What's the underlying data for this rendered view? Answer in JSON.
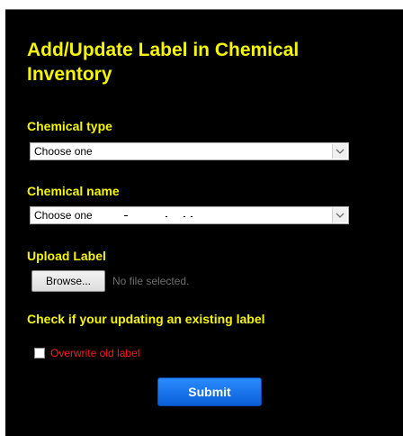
{
  "form": {
    "title": "Add/Update Label in Chemical Inventory",
    "chemical_type": {
      "label": "Chemical type",
      "selected": "Choose one"
    },
    "chemical_name": {
      "label": "Chemical name",
      "selected": "Choose one"
    },
    "upload": {
      "label": "Upload Label",
      "browse_label": "Browse...",
      "status": "No file selected."
    },
    "overwrite": {
      "heading": "Check if your updating an existing label",
      "checkbox_label": "Overwrite old label",
      "checked": false
    },
    "submit_label": "Submit"
  },
  "colors": {
    "background": "#000000",
    "heading": "#f5f500",
    "checkbox_label": "#ff1a1a",
    "submit": "#1e7bf0"
  },
  "icons": {
    "dropdown": "chevron-down-icon"
  }
}
